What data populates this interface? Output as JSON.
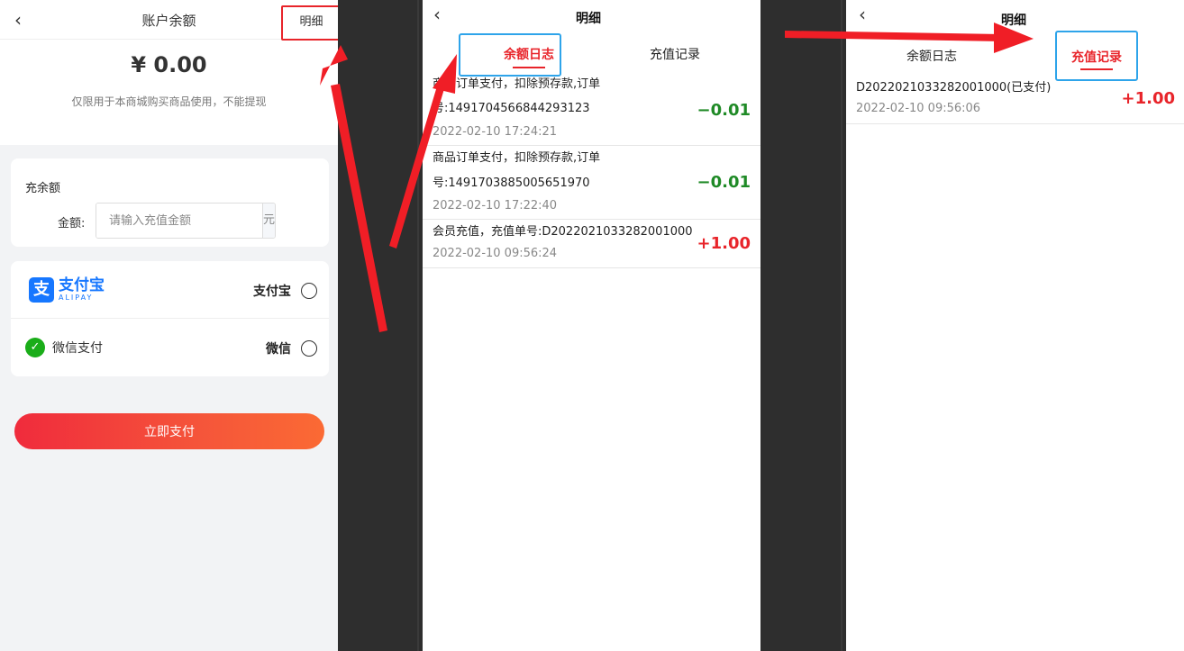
{
  "balance_page": {
    "back_icon": "chevron-left-icon",
    "title": "账户余额",
    "detail_link": "明细",
    "balance": "¥ 0.00",
    "note": "仅限用于本商城购买商品使用，不能提现",
    "recharge": {
      "label": "充余额",
      "amount_label": "金额:",
      "amount_placeholder": "请输入充值金额",
      "amount_value": "",
      "unit": "元"
    },
    "payment_methods": [
      {
        "icon": "alipay-logo-icon",
        "logo_mark": "支",
        "logo_cn": "支付宝",
        "logo_en": "ALIPAY",
        "name": "支付宝",
        "selected": false
      },
      {
        "icon": "wechat-logo-icon",
        "logo_text": "微信支付",
        "name": "微信",
        "selected": false
      }
    ],
    "pay_button": "立即支付"
  },
  "detail_page_log": {
    "back_icon": "chevron-left-icon",
    "title": "明细",
    "tabs": [
      {
        "label": "余额日志",
        "active": true
      },
      {
        "label": "充值记录",
        "active": false
      }
    ],
    "entries": [
      {
        "desc_line1": "商品订单支付，扣除预存款,订单",
        "desc_line2": "号:1491704566844293123",
        "time": "2022-02-10 17:24:21",
        "amount": "−0.01",
        "sign": "negative"
      },
      {
        "desc_line1": "商品订单支付，扣除预存款,订单",
        "desc_line2": "号:1491703885005651970",
        "time": "2022-02-10 17:22:40",
        "amount": "−0.01",
        "sign": "negative"
      },
      {
        "desc_line1": "会员充值，充值单号:D2022021033282001000",
        "time": "2022-02-10 09:56:24",
        "amount": "+1.00",
        "sign": "positive"
      }
    ]
  },
  "detail_page_recharge": {
    "back_icon": "chevron-left-icon",
    "title": "明细",
    "tabs": [
      {
        "label": "余额日志",
        "active": false
      },
      {
        "label": "充值记录",
        "active": true
      }
    ],
    "entries": [
      {
        "desc": "D2022021033282001000(已支付)",
        "time": "2022-02-10 09:56:06",
        "amount": "+1.00",
        "sign": "positive"
      }
    ]
  },
  "colors": {
    "accent_red": "#e8242a",
    "highlight_blue": "#2ea4ea",
    "negative_green": "#1f8a26",
    "alipay_blue": "#1677ff",
    "wechat_green": "#1aad19"
  }
}
